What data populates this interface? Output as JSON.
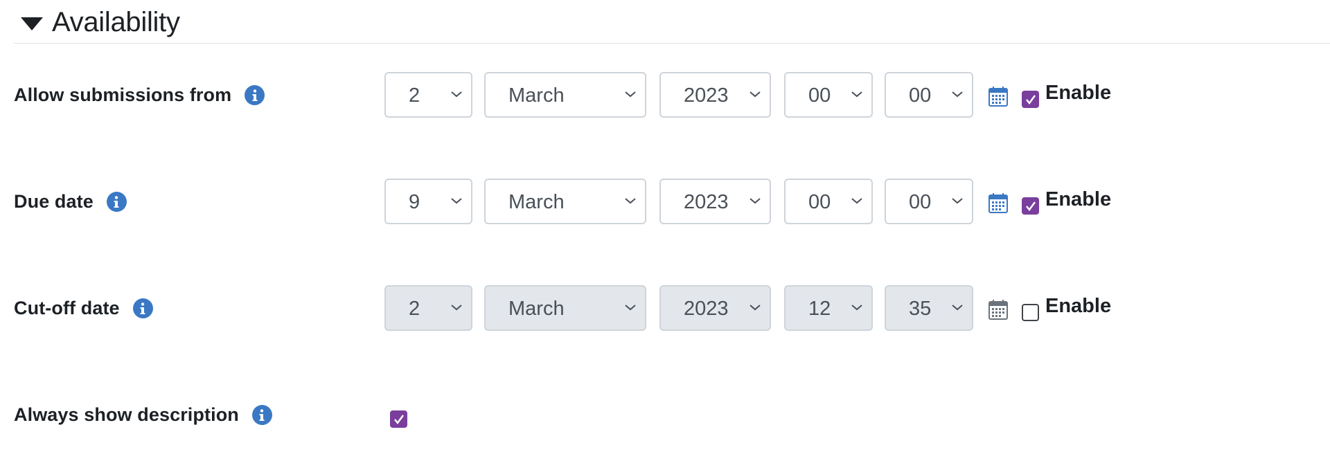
{
  "section": {
    "title": "Availability"
  },
  "rows": [
    {
      "label": "Allow submissions from",
      "day": "2",
      "month": "March",
      "year": "2023",
      "hour": "00",
      "minute": "00",
      "enabled": true,
      "enable_label": "Enable"
    },
    {
      "label": "Due date",
      "day": "9",
      "month": "March",
      "year": "2023",
      "hour": "00",
      "minute": "00",
      "enabled": true,
      "enable_label": "Enable"
    },
    {
      "label": "Cut-off date",
      "day": "2",
      "month": "March",
      "year": "2023",
      "hour": "12",
      "minute": "35",
      "enabled": false,
      "enable_label": "Enable"
    }
  ],
  "always_show": {
    "label": "Always show description",
    "checked": true
  },
  "icons": {
    "collapse": "triangle-down-icon",
    "info": "info-icon",
    "calendar": "calendar-icon",
    "select_arrow": "chevron-down-icon",
    "check": "checkmark-icon"
  },
  "colors": {
    "accent_checkbox": "#7a3e9c",
    "info_icon": "#3a78c4",
    "calendar_active": "#3a78c4",
    "calendar_disabled": "#6a737b",
    "disabled_field": "#e3e6ea",
    "border": "#ced4da"
  }
}
